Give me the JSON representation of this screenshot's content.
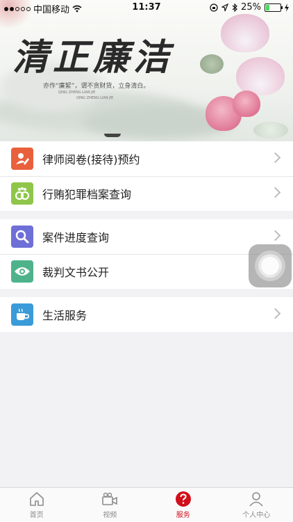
{
  "status_bar": {
    "carrier": "中国移动",
    "time": "11:37",
    "battery": "25%",
    "battery_level": 0.25
  },
  "banner": {
    "title": "清正廉洁",
    "slogan": "亦作“廉絜”，谓不贪财货，立身清白。",
    "sub1": "QING ZHENG LIAN JIE",
    "sub2": "QING ZHENG LIAN JIE"
  },
  "menu": {
    "group1": [
      {
        "label": "律师阅卷(接待)预约",
        "icon": "lawyer-edit-icon",
        "color": "#e8613c"
      },
      {
        "label": "行贿犯罪档案查询",
        "icon": "handcuffs-icon",
        "color": "#8fc64a"
      }
    ],
    "group2": [
      {
        "label": "案件进度查询",
        "icon": "search-icon",
        "color": "#6f6fd8"
      },
      {
        "label": "裁判文书公开",
        "icon": "eye-icon",
        "color": "#4eb38b"
      }
    ],
    "group3": [
      {
        "label": "生活服务",
        "icon": "coffee-cup-icon",
        "color": "#3a9bd8"
      }
    ]
  },
  "tabbar": {
    "items": [
      {
        "label": "首页",
        "icon": "home-icon"
      },
      {
        "label": "视频",
        "icon": "video-camera-icon"
      },
      {
        "label": "服务",
        "icon": "question-icon",
        "active": true
      },
      {
        "label": "个人中心",
        "icon": "user-icon"
      }
    ],
    "active_color": "#d0101b"
  }
}
